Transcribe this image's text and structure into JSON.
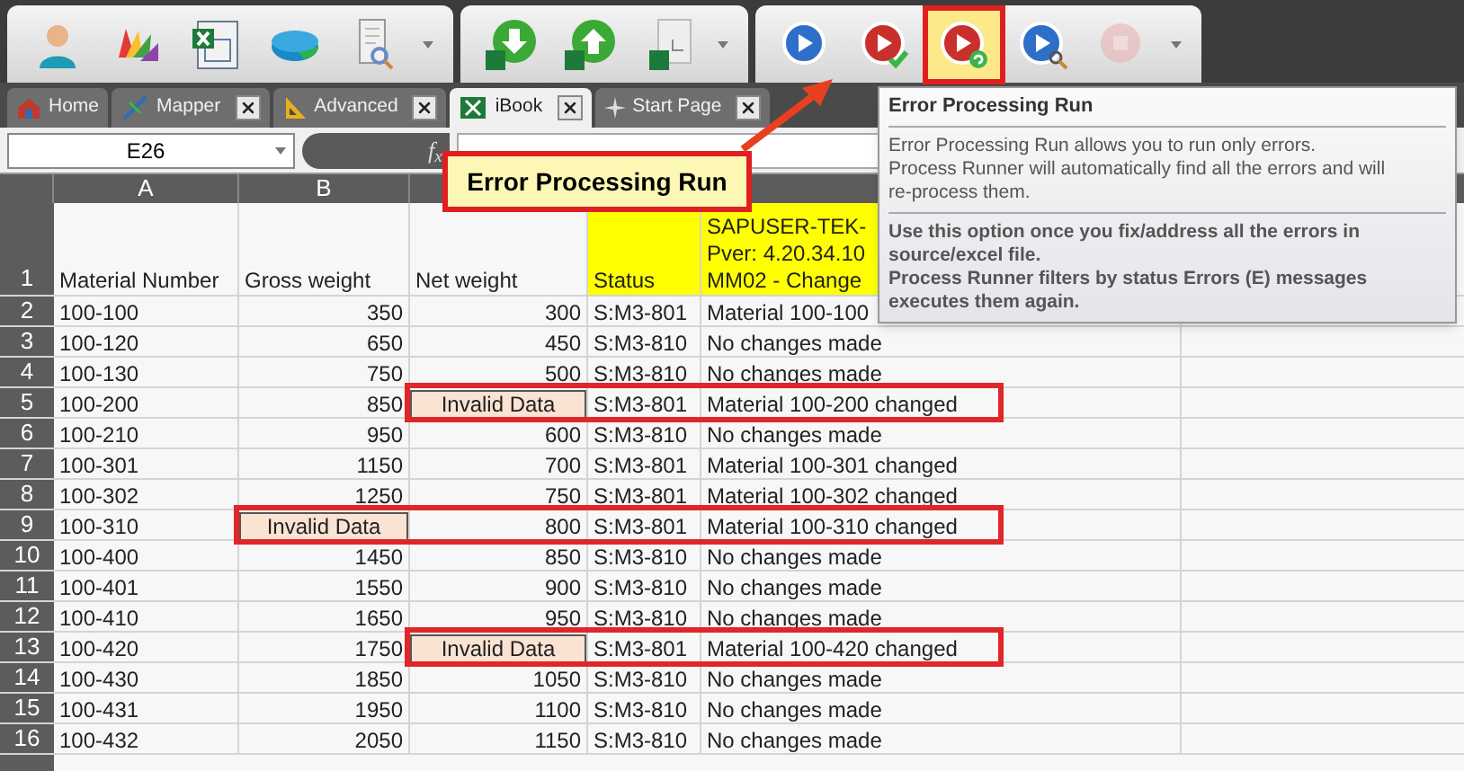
{
  "toolbar": {
    "groups": [
      {
        "buttons": [
          {
            "kind": "user",
            "selected": false,
            "disabled": false
          },
          {
            "kind": "palette",
            "selected": false,
            "disabled": false
          },
          {
            "kind": "sheet",
            "selected": false,
            "disabled": false
          },
          {
            "kind": "pie",
            "selected": false,
            "disabled": false
          },
          {
            "kind": "finder",
            "selected": false,
            "disabled": false
          }
        ]
      },
      {
        "buttons": [
          {
            "kind": "download",
            "selected": false,
            "disabled": false
          },
          {
            "kind": "upload",
            "selected": false,
            "disabled": false
          },
          {
            "kind": "page",
            "selected": false,
            "disabled": false
          }
        ]
      },
      {
        "buttons": [
          {
            "kind": "play",
            "selected": false,
            "disabled": false
          },
          {
            "kind": "approve",
            "selected": false,
            "disabled": false
          },
          {
            "kind": "retry",
            "selected": true,
            "disabled": false
          },
          {
            "kind": "inspect",
            "selected": false,
            "disabled": false
          },
          {
            "kind": "stop",
            "selected": false,
            "disabled": true
          }
        ]
      }
    ]
  },
  "tabs": [
    {
      "label": "Home",
      "kind": "home",
      "selected": false,
      "closable": false
    },
    {
      "label": "Mapper",
      "kind": "mapper",
      "selected": false,
      "closable": true
    },
    {
      "label": "Advanced",
      "kind": "advanced",
      "selected": false,
      "closable": true
    },
    {
      "label": "iBook",
      "kind": "book",
      "selected": true,
      "closable": true
    },
    {
      "label": "Start Page",
      "kind": "start",
      "selected": false,
      "closable": true
    }
  ],
  "formula_bar": {
    "name_box": "E26",
    "function_label": "f$_{x}$"
  },
  "sheet": {
    "columns": [
      "A",
      "B"
    ],
    "header_row": {
      "number": "1",
      "cells": [
        {
          "lines": [
            "Material Number"
          ],
          "marked": false
        },
        {
          "lines": [
            "Gross weight"
          ],
          "marked": false
        },
        {
          "lines": [
            "Net weight"
          ],
          "marked": false
        },
        {
          "lines": [
            "Status"
          ],
          "marked": true
        },
        {
          "lines": [
            "SAPUSER-TEK-",
            "Pver: 4.20.34.10",
            "MM02 - Change"
          ],
          "marked": true
        }
      ]
    },
    "rows": [
      {
        "number": "2",
        "cells": [
          "100-100",
          "350",
          "300",
          "S:M3-801",
          "Material 100-100"
        ],
        "framed": false
      },
      {
        "number": "3",
        "cells": [
          "100-120",
          "650",
          "450",
          "S:M3-810",
          "No changes made"
        ],
        "framed": false
      },
      {
        "number": "4",
        "cells": [
          "100-130",
          "750",
          "500",
          "S:M3-810",
          "No changes made"
        ],
        "framed": false
      },
      {
        "number": "5",
        "cells": [
          "100-200",
          "850",
          {
            "text": "Invalid Data",
            "invalid": true
          },
          "S:M3-801",
          "Material 100-200 changed"
        ],
        "framed": true
      },
      {
        "number": "6",
        "cells": [
          "100-210",
          "950",
          "600",
          "S:M3-810",
          "No changes made"
        ],
        "framed": false
      },
      {
        "number": "7",
        "cells": [
          "100-301",
          "1150",
          "700",
          "S:M3-801",
          "Material 100-301 changed"
        ],
        "framed": false
      },
      {
        "number": "8",
        "cells": [
          "100-302",
          "1250",
          "750",
          "S:M3-801",
          "Material 100-302 changed"
        ],
        "framed": false
      },
      {
        "number": "9",
        "cells": [
          "100-310",
          {
            "text": "Invalid Data",
            "invalid": true
          },
          "800",
          "S:M3-801",
          "Material 100-310 changed"
        ],
        "framed": true
      },
      {
        "number": "10",
        "cells": [
          "100-400",
          "1450",
          "850",
          "S:M3-810",
          "No changes made"
        ],
        "framed": false
      },
      {
        "number": "11",
        "cells": [
          "100-401",
          "1550",
          "900",
          "S:M3-810",
          "No changes made"
        ],
        "framed": false
      },
      {
        "number": "12",
        "cells": [
          "100-410",
          "1650",
          "950",
          "S:M3-810",
          "No changes made"
        ],
        "framed": false
      },
      {
        "number": "13",
        "cells": [
          "100-420",
          "1750",
          {
            "text": "Invalid Data",
            "invalid": true
          },
          "S:M3-801",
          "Material 100-420 changed"
        ],
        "framed": true
      },
      {
        "number": "14",
        "cells": [
          "100-430",
          "1850",
          "1050",
          "S:M3-810",
          "No changes made"
        ],
        "framed": false
      },
      {
        "number": "15",
        "cells": [
          "100-431",
          "1950",
          "1100",
          "S:M3-810",
          "No changes made"
        ],
        "framed": false
      },
      {
        "number": "16",
        "cells": [
          "100-432",
          "2050",
          "1150",
          "S:M3-810",
          "No changes made"
        ],
        "framed": false
      }
    ]
  },
  "callout": {
    "text": "Error Processing Run"
  },
  "tooltip": {
    "title": "Error Processing Run",
    "description": "Error Processing Run allows you to run only errors.\nProcess Runner will automatically find all the errors and will\nre-process them.",
    "note": "Use this option once you fix/address all the errors in\nsource/excel file.\nProcess Runner filters by status Errors (E) messages\nexecutes them again."
  }
}
